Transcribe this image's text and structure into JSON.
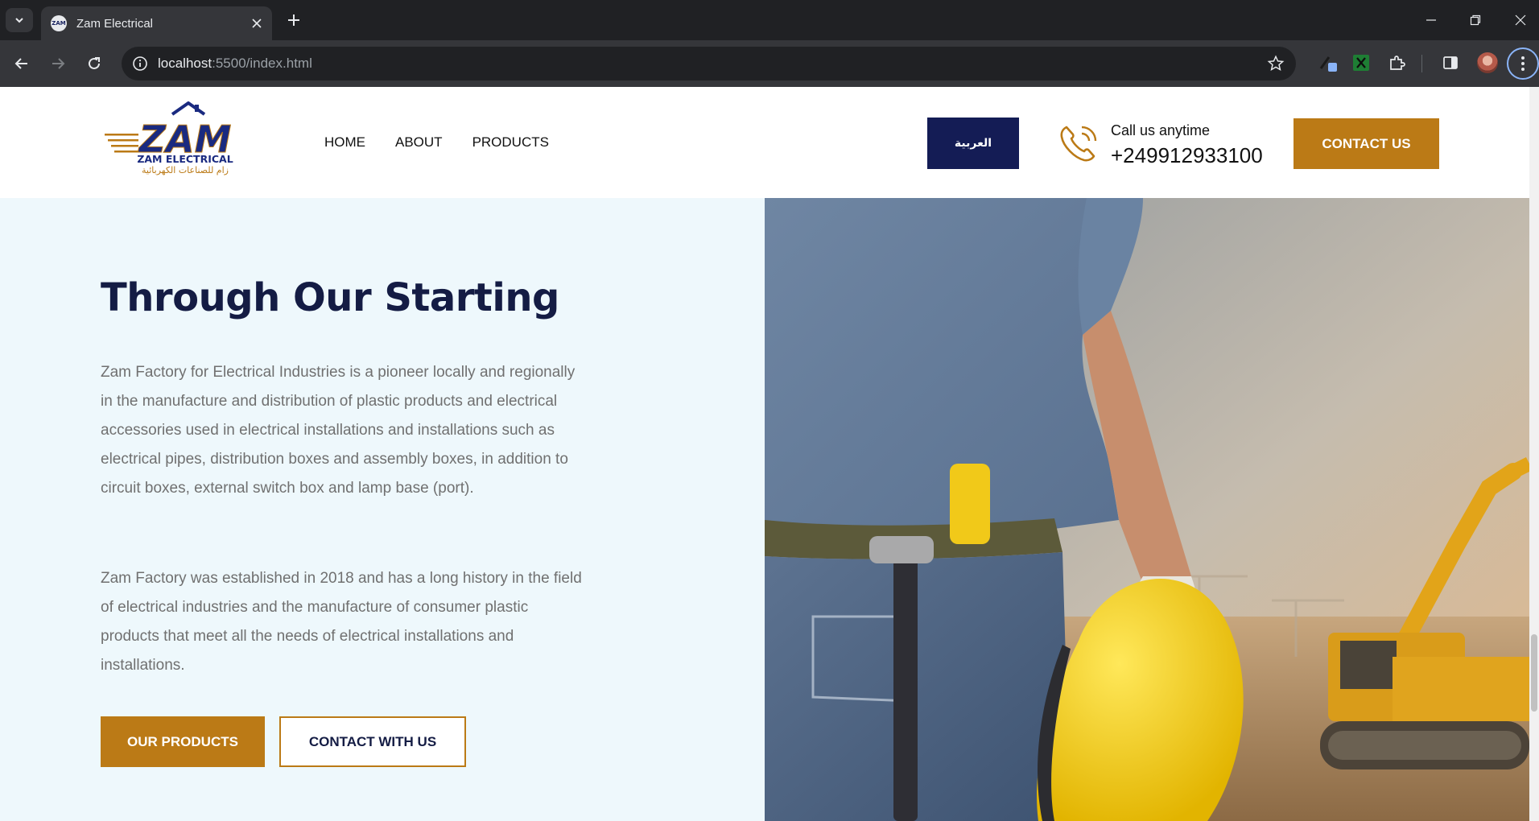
{
  "browser": {
    "tab_title": "Zam Electrical",
    "url_host": "localhost",
    "url_rest": ":5500/index.html"
  },
  "header": {
    "logo_word": "ZAM",
    "logo_subtitle": "ZAM ELECTRICAL",
    "logo_arabic": "زام للصناعات الكهربائية",
    "nav": [
      "HOME",
      "ABOUT",
      "PRODUCTS"
    ],
    "language_button": "العربية",
    "call_label": "Call us anytime",
    "call_number": "+24991293310​0",
    "contact_button": "CONTACT US"
  },
  "hero": {
    "title": "Through Our Starting",
    "paragraph1": "Zam Factory for Electrical Industries is a pioneer locally and regionally in the manufacture and distribution of plastic products and electrical accessories used in electrical installations and installations such as electrical pipes, distribution boxes and assembly boxes, in addition to circuit boxes, external switch box and lamp base (port).",
    "paragraph2": "Zam Factory was established in 2018 and has a long history in the field of electrical industries and the manufacture of consumer plastic products that meet all the needs of electrical installations and installations.",
    "primary_button": "OUR PRODUCTS",
    "secondary_button": "CONTACT WITH US"
  },
  "colors": {
    "brand_navy": "#141c55",
    "brand_gold": "#bb7a16",
    "hero_bg": "#eef8fc"
  },
  "icons": [
    "tab-list-icon",
    "close-icon",
    "plus-icon",
    "minimize-icon",
    "restore-icon",
    "back-icon",
    "forward-icon",
    "reload-icon",
    "info-icon",
    "star-icon",
    "extension-icon",
    "puzzle-icon",
    "side-panel-icon",
    "more-icon",
    "phone-icon"
  ]
}
